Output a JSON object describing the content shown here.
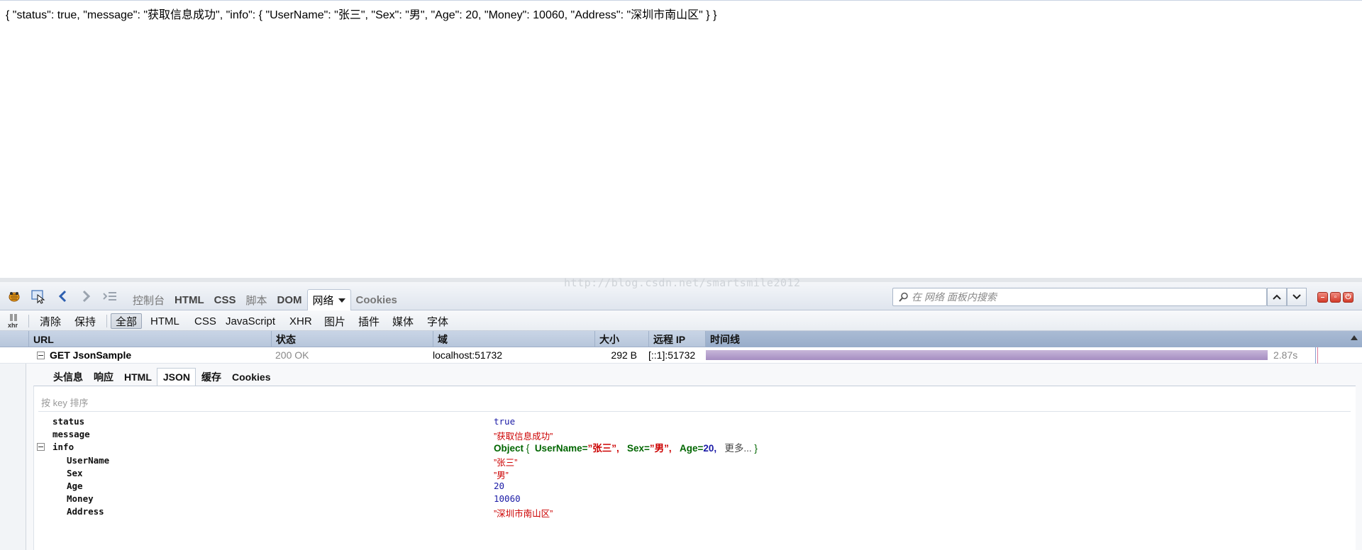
{
  "page": {
    "raw_json": "{ \"status\": true, \"message\": \"获取信息成功\", \"info\": { \"UserName\": \"张三\", \"Sex\": \"男\", \"Age\": 20, \"Money\": 10060, \"Address\": \"深圳市南山区\" } }"
  },
  "watermark": "http://blog.csdn.net/smartsmile2012",
  "toolbar": {
    "icons": [
      "firebug-icon",
      "inspect-icon",
      "back-icon",
      "forward-icon",
      "command-line-icon"
    ],
    "panel_tabs": [
      {
        "label": "控制台",
        "active": false
      },
      {
        "label": "HTML",
        "active": false
      },
      {
        "label": "CSS",
        "active": false
      },
      {
        "label": "脚本",
        "active": false
      },
      {
        "label": "DOM",
        "active": false
      },
      {
        "label": "网络",
        "active": true
      },
      {
        "label": "Cookies",
        "active": false
      }
    ],
    "search_placeholder": "在 网络 面板内搜索"
  },
  "net_toolbar": {
    "xhr_label": "xhr",
    "clear_label": "清除",
    "persist_label": "保持",
    "filters": [
      "全部",
      "HTML",
      "CSS",
      "JavaScript",
      "XHR",
      "图片",
      "插件",
      "媒体",
      "字体"
    ],
    "active_filter": "全部"
  },
  "columns": {
    "url": "URL",
    "status": "状态",
    "domain": "域",
    "size": "大小",
    "remote_ip": "远程 IP",
    "timeline": "时间线"
  },
  "request": {
    "url": "GET JsonSample",
    "status": "200 OK",
    "domain": "localhost:51732",
    "size": "292 B",
    "remote_ip": "[::1]:51732",
    "time": "2.87s"
  },
  "detail_tabs": [
    {
      "label": "头信息",
      "active": false
    },
    {
      "label": "响应",
      "active": false
    },
    {
      "label": "HTML",
      "active": false
    },
    {
      "label": "JSON",
      "active": true
    },
    {
      "label": "缓存",
      "active": false
    },
    {
      "label": "Cookies",
      "active": false
    }
  ],
  "json_view": {
    "sort_hint": "按 key 排序",
    "rows": [
      {
        "key": "status",
        "value": "true",
        "type": "bool"
      },
      {
        "key": "message",
        "value": "”获取信息成功”",
        "type": "str"
      },
      {
        "key": "info",
        "type": "obj"
      },
      {
        "key": "UserName",
        "value": "”张三”",
        "type": "str"
      },
      {
        "key": "Sex",
        "value": "”男”",
        "type": "str"
      },
      {
        "key": "Age",
        "value": "20",
        "type": "num"
      },
      {
        "key": "Money",
        "value": "10060",
        "type": "num"
      },
      {
        "key": "Address",
        "value": "”深圳市南山区”",
        "type": "str"
      }
    ],
    "info_summary": {
      "prefix": "Object",
      "open": "{",
      "k1": "UserName=",
      "v1": "”张三”,",
      "k2": "Sex=",
      "v2": "”男”,",
      "k3": "Age=",
      "v3": "20,",
      "more": "更多...",
      "close": "}"
    }
  },
  "colors": {
    "timeline_bar": "#a58dc1",
    "string_value": "#cc0000",
    "number_value": "#1a1aa6",
    "object_value": "#006600"
  }
}
